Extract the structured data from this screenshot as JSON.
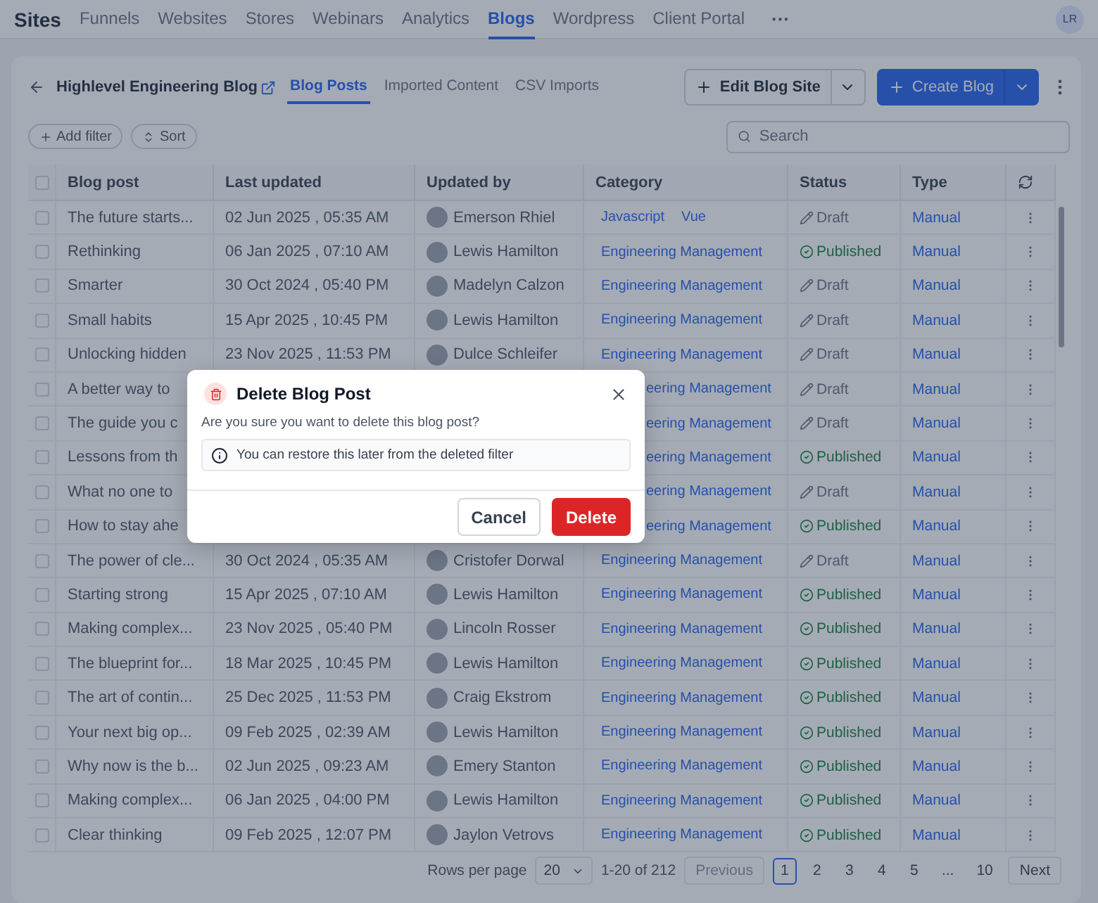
{
  "app": {
    "title": "Sites",
    "avatar": "LR",
    "more": "···"
  },
  "nav": [
    {
      "label": "Funnels",
      "selected": false
    },
    {
      "label": "Websites",
      "selected": false
    },
    {
      "label": "Stores",
      "selected": false
    },
    {
      "label": "Webinars",
      "selected": false
    },
    {
      "label": "Analytics",
      "selected": false
    },
    {
      "label": "Blogs",
      "selected": true
    },
    {
      "label": "Wordpress",
      "selected": false
    },
    {
      "label": "Client Portal",
      "selected": false
    }
  ],
  "blog": {
    "title": "Highlevel Engineering Blog"
  },
  "subtabs": [
    {
      "label": "Blog Posts",
      "selected": true
    },
    {
      "label": "Imported Content",
      "selected": false
    },
    {
      "label": "CSV Imports",
      "selected": false
    }
  ],
  "actions": {
    "edit": "Edit Blog Site",
    "create": "Create Blog"
  },
  "filters": {
    "add": "Add filter",
    "sort": "Sort"
  },
  "search": {
    "placeholder": "Search"
  },
  "table": {
    "all_checked": false,
    "columns": [
      "Blog post",
      "Last updated",
      "Updated by",
      "Category",
      "Status",
      "Type"
    ],
    "rows": [
      {
        "checked": false,
        "title": "The future starts...",
        "updated": "02 Jun 2025 , 05:35 AM",
        "by": "Emerson Rhiel",
        "categories": [
          "Javascript",
          "Vue"
        ],
        "status": {
          "kind": "draft",
          "label": "Draft"
        },
        "type": "Manual"
      },
      {
        "checked": false,
        "title": "Rethinking",
        "updated": "06 Jan 2025 , 07:10 AM",
        "by": "Lewis Hamilton",
        "categories": [
          "Engineering Management"
        ],
        "status": {
          "kind": "published",
          "label": "Published"
        },
        "type": "Manual"
      },
      {
        "checked": false,
        "title": "Smarter",
        "updated": "30 Oct 2024 , 05:40 PM",
        "by": "Madelyn Calzon",
        "categories": [
          "Engineering Management"
        ],
        "status": {
          "kind": "draft",
          "label": "Draft"
        },
        "type": "Manual"
      },
      {
        "checked": false,
        "title": "Small habits",
        "updated": "15 Apr 2025 , 10:45 PM",
        "by": "Lewis Hamilton",
        "categories": [
          "Engineering Management"
        ],
        "status": {
          "kind": "draft",
          "label": "Draft"
        },
        "type": "Manual"
      },
      {
        "checked": false,
        "title": "Unlocking hidden",
        "updated": "23 Nov 2025 , 11:53 PM",
        "by": "Dulce Schleifer",
        "categories": [
          "Engineering Management"
        ],
        "status": {
          "kind": "draft",
          "label": "Draft"
        },
        "type": "Manual"
      },
      {
        "checked": false,
        "title": "A better way to",
        "categories": [
          "eering Management"
        ],
        "status": {
          "kind": "draft",
          "label": "Draft"
        },
        "type": "Manual"
      },
      {
        "checked": false,
        "title": "The guide you c",
        "categories": [
          "eering Management"
        ],
        "status": {
          "kind": "draft",
          "label": "Draft"
        },
        "type": "Manual"
      },
      {
        "checked": false,
        "title": "Lessons from th",
        "categories": [
          "eering Management"
        ],
        "status": {
          "kind": "published",
          "label": "Published"
        },
        "type": "Manual"
      },
      {
        "checked": false,
        "title": "What no one to",
        "categories": [
          "eering Management"
        ],
        "status": {
          "kind": "draft",
          "label": "Draft"
        },
        "type": "Manual"
      },
      {
        "checked": false,
        "title": "How to stay ahe",
        "categories": [
          "eering Management"
        ],
        "status": {
          "kind": "published",
          "label": "Published"
        },
        "type": "Manual"
      },
      {
        "checked": false,
        "title": "The power of cle...",
        "updated": "30 Oct 2024 , 05:35 AM",
        "by": "Cristofer Dorwal",
        "categories": [
          "Engineering Management"
        ],
        "status": {
          "kind": "draft",
          "label": "Draft"
        },
        "type": "Manual"
      },
      {
        "checked": false,
        "title": "Starting strong",
        "updated": "15 Apr 2025 , 07:10 AM",
        "by": "Lewis Hamilton",
        "categories": [
          "Engineering Management"
        ],
        "status": {
          "kind": "published",
          "label": "Published"
        },
        "type": "Manual"
      },
      {
        "checked": false,
        "title": "Making complex...",
        "updated": "23 Nov 2025 , 05:40 PM",
        "by": "Lincoln Rosser",
        "categories": [
          "Engineering Management"
        ],
        "status": {
          "kind": "published",
          "label": "Published"
        },
        "type": "Manual"
      },
      {
        "checked": false,
        "title": "The blueprint for...",
        "updated": "18 Mar 2025 , 10:45 PM",
        "by": "Lewis Hamilton",
        "categories": [
          "Engineering Management"
        ],
        "status": {
          "kind": "published",
          "label": "Published"
        },
        "type": "Manual"
      },
      {
        "checked": false,
        "title": "The art of contin...",
        "updated": "25 Dec 2025 , 11:53 PM",
        "by": "Craig Ekstrom",
        "categories": [
          "Engineering Management"
        ],
        "status": {
          "kind": "published",
          "label": "Published"
        },
        "type": "Manual"
      },
      {
        "checked": false,
        "title": "Your next big op...",
        "updated": "09 Feb 2025 , 02:39 AM",
        "by": "Lewis Hamilton",
        "categories": [
          "Engineering Management"
        ],
        "status": {
          "kind": "published",
          "label": "Published"
        },
        "type": "Manual"
      },
      {
        "checked": false,
        "title": "Why now is the b...",
        "updated": "02 Jun 2025 , 09:23 AM",
        "by": "Emery Stanton",
        "categories": [
          "Engineering Management"
        ],
        "status": {
          "kind": "published",
          "label": "Published"
        },
        "type": "Manual"
      },
      {
        "checked": false,
        "title": "Making complex...",
        "updated": "06 Jan 2025 , 04:00 PM",
        "by": "Lewis Hamilton",
        "categories": [
          "Engineering Management"
        ],
        "status": {
          "kind": "published",
          "label": "Published"
        },
        "type": "Manual"
      },
      {
        "checked": false,
        "title": "Clear thinking",
        "updated": "09 Feb 2025 , 12:07 PM",
        "by": "Jaylon Vetrovs",
        "categories": [
          "Engineering Management"
        ],
        "status": {
          "kind": "published",
          "label": "Published"
        },
        "type": "Manual"
      }
    ]
  },
  "pagination": {
    "rows_label": "Rows per page",
    "per_page": "20",
    "range": "1-20 of 212",
    "previous": "Previous",
    "next": "Next",
    "pages": [
      {
        "label": "1",
        "selected": true
      },
      {
        "label": "2",
        "selected": false
      },
      {
        "label": "3",
        "selected": false
      },
      {
        "label": "4",
        "selected": false
      },
      {
        "label": "5",
        "selected": false
      },
      {
        "label": "...",
        "selected": false
      },
      {
        "label": "10",
        "selected": false
      }
    ]
  },
  "dialog": {
    "title": "Delete Blog Post",
    "message": "Are you sure you want to delete this blog post?",
    "note": "You can restore this later from the deleted filter",
    "cancel": "Cancel",
    "confirm": "Delete"
  }
}
